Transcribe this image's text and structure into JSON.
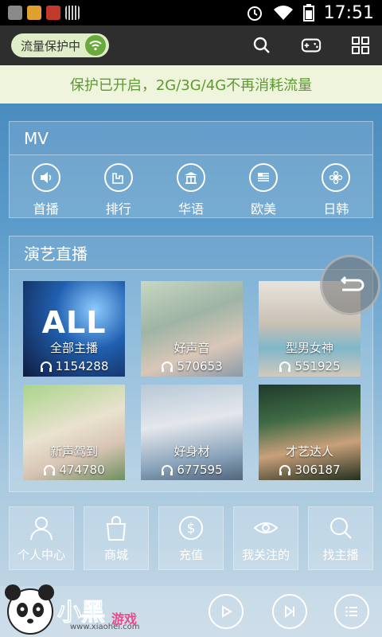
{
  "status_bar": {
    "time": "17:51"
  },
  "top_bar": {
    "flow_protection_label": "流量保护中",
    "icons": [
      "search-icon",
      "gamepad-icon",
      "grid-icon"
    ]
  },
  "banner": {
    "text": "保护已开启，2G/3G/4G不再消耗流量"
  },
  "mv": {
    "title": "MV",
    "items": [
      {
        "label": "首播",
        "icon": "speaker-icon"
      },
      {
        "label": "排行",
        "icon": "chart-icon"
      },
      {
        "label": "华语",
        "icon": "temple-icon"
      },
      {
        "label": "欧美",
        "icon": "flag-icon"
      },
      {
        "label": "日韩",
        "icon": "flower-icon"
      }
    ]
  },
  "live": {
    "title": "演艺直播",
    "tiles": [
      {
        "name": "全部主播",
        "count": "1154288",
        "overlay": "ALL"
      },
      {
        "name": "好声音",
        "count": "570653"
      },
      {
        "name": "型男女神",
        "count": "551925"
      },
      {
        "name": "新声驾到",
        "count": "474780"
      },
      {
        "name": "好身材",
        "count": "677595"
      },
      {
        "name": "才艺达人",
        "count": "306187"
      }
    ]
  },
  "bottom_nav": [
    {
      "label": "个人中心",
      "icon": "person-icon"
    },
    {
      "label": "商城",
      "icon": "bag-icon"
    },
    {
      "label": "充值",
      "icon": "dollar-icon"
    },
    {
      "label": "我关注的",
      "icon": "eye-icon"
    },
    {
      "label": "找主播",
      "icon": "search-icon"
    }
  ],
  "watermark": {
    "brand": "小黑",
    "sub": "游戏",
    "url": "www.xiaohei.com"
  },
  "colors": {
    "accent_green": "#5e9a2f",
    "topbar": "#2e2e2e"
  }
}
